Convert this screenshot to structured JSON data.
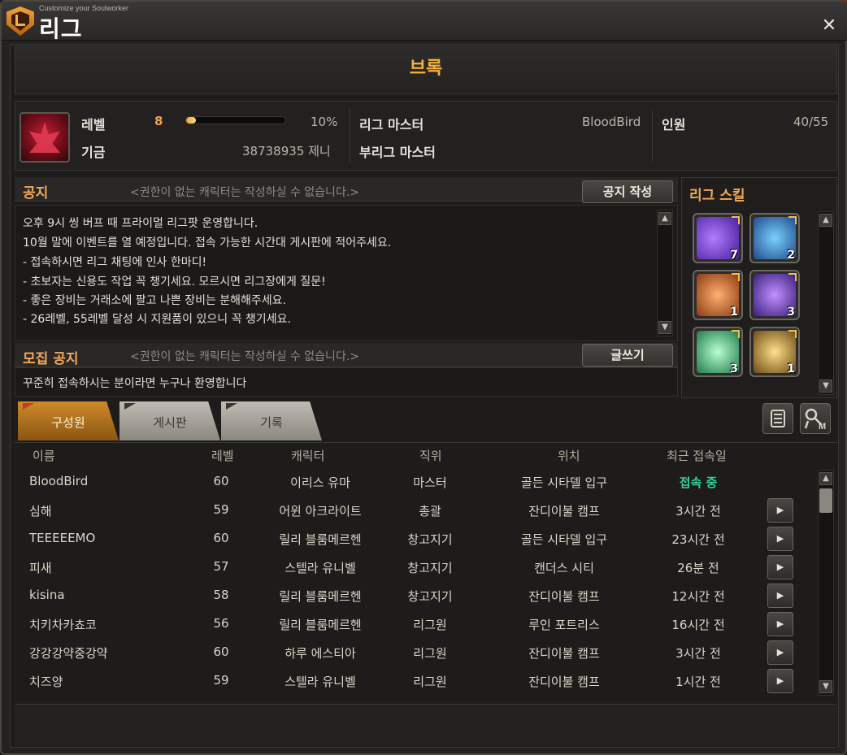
{
  "window": {
    "subtitle": "Customize your Soulworker",
    "title": "리그",
    "close_label": "✕"
  },
  "guild": {
    "name": "브록",
    "level_label": "레벨",
    "level": "8",
    "xp_percent_text": "10%",
    "xp_fraction": 0.1,
    "fund_label": "기금",
    "fund_value": "38738935 제니",
    "master_label": "리그 마스터",
    "master_value": "BloodBird",
    "submaster_label": "부리그 마스터",
    "members_label": "인원",
    "members_value": "40/55"
  },
  "notice": {
    "title": "공지",
    "hint": "<권한이 없는 캐릭터는 작성하실 수 없습니다.>",
    "button": "공지 작성",
    "lines": [
      "오후 9시 씽 버프 때 프라이멀 리그팟 운영합니다.",
      "10월 말에 이벤트를 열 예정입니다. 접속 가능한 시간대 게시판에 적어주세요.",
      "- 접속하시면 리그 채팅에 인사 한마디!",
      "- 초보자는 신용도 작업 꼭 챙기세요. 모르시면 리그장에게 질문!",
      "- 좋은 장비는 거래소에 팔고 나쁜 장비는 분해해주세요.",
      "- 26레벨, 55레벨 달성 시 지원품이 있으니 꼭 챙기세요."
    ]
  },
  "recruit": {
    "title": "모집 공지",
    "hint": "<권한이 없는 캐릭터는 작성하실 수 없습니다.>",
    "button": "글쓰기",
    "text": "꾸준히 접속하시는 분이라면 누구나 환영합니다"
  },
  "skills": {
    "title": "리그 스킬",
    "items": [
      {
        "icon": "member-add-icon",
        "count": "7",
        "color": "#7a4ad8"
      },
      {
        "icon": "storage-icon",
        "count": "2",
        "color": "#2a7ac8"
      },
      {
        "icon": "heart-knot-icon",
        "count": "1",
        "color": "#d86a2a"
      },
      {
        "icon": "group-icon",
        "count": "3",
        "color": "#6a3ab8"
      },
      {
        "icon": "speed-gauge-icon",
        "count": "3",
        "color": "#3aa86a"
      },
      {
        "icon": "exchange-icon",
        "count": "1",
        "color": "#b8942a"
      }
    ]
  },
  "tabs": [
    {
      "label": "구성원",
      "active": true
    },
    {
      "label": "게시판",
      "active": false
    },
    {
      "label": "기록",
      "active": false
    }
  ],
  "table": {
    "headers": [
      "이름",
      "레벨",
      "캐릭터",
      "직위",
      "위치",
      "최근 접속일"
    ],
    "rows": [
      {
        "name": "BloodBird",
        "level": "60",
        "character": "이리스 유마",
        "rank": "마스터",
        "location": "골든 시타델 입구",
        "last": "접속 중",
        "online": true
      },
      {
        "name": "심해",
        "level": "59",
        "character": "어윈 아크라이트",
        "rank": "총괄",
        "location": "잔디이불 캠프",
        "last": "3시간 전",
        "online": false
      },
      {
        "name": "TEEEEEMO",
        "level": "60",
        "character": "릴리 블룸메르헨",
        "rank": "창고지기",
        "location": "골든 시타델 입구",
        "last": "23시간 전",
        "online": false
      },
      {
        "name": "피새",
        "level": "57",
        "character": "스텔라 유니벨",
        "rank": "창고지기",
        "location": "캔더스 시티",
        "last": "26분 전",
        "online": false
      },
      {
        "name": "kisina",
        "level": "58",
        "character": "릴리 블룸메르헨",
        "rank": "창고지기",
        "location": "잔디이불 캠프",
        "last": "12시간 전",
        "online": false
      },
      {
        "name": "치키차카쵸코",
        "level": "56",
        "character": "릴리 블룸메르헨",
        "rank": "리그원",
        "location": "루인 포트리스",
        "last": "16시간 전",
        "online": false
      },
      {
        "name": "강강강약중강약",
        "level": "60",
        "character": "하루 에스티아",
        "rank": "리그원",
        "location": "잔디이불 캠프",
        "last": "3시간 전",
        "online": false
      },
      {
        "name": "치즈양",
        "level": "59",
        "character": "스텔라 유니벨",
        "rank": "리그원",
        "location": "잔디이불 캠프",
        "last": "1시간 전",
        "online": false
      }
    ]
  }
}
